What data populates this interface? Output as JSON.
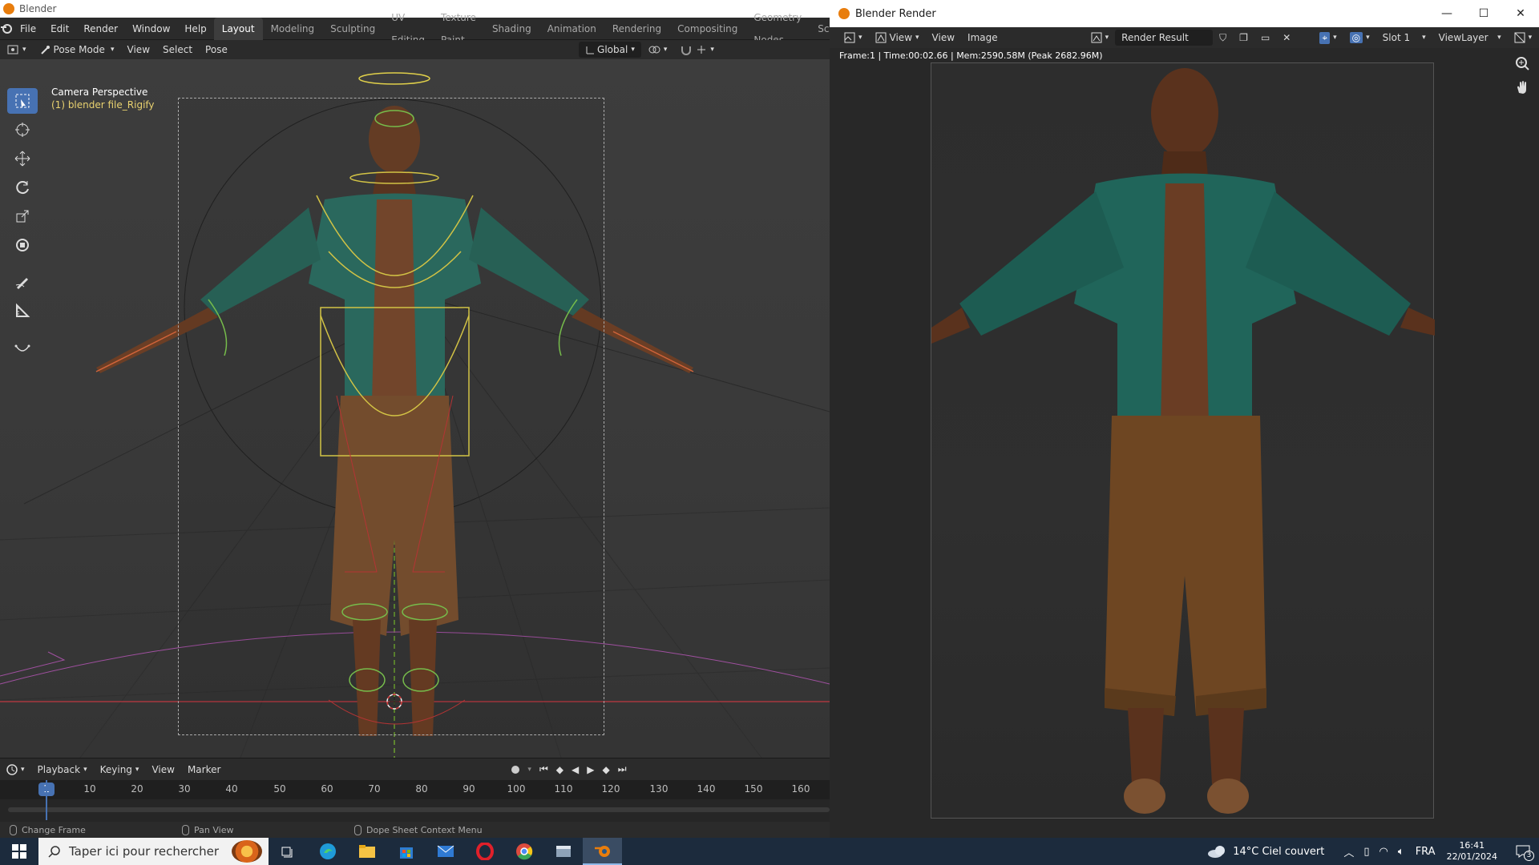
{
  "main_window": {
    "title": "Blender",
    "menu": [
      "File",
      "Edit",
      "Render",
      "Window",
      "Help"
    ],
    "workspaces": [
      "Layout",
      "Modeling",
      "Sculpting",
      "UV Editing",
      "Texture Paint",
      "Shading",
      "Animation",
      "Rendering",
      "Compositing",
      "Geometry Nodes",
      "Scriptin"
    ],
    "active_workspace": "Layout"
  },
  "viewport_header": {
    "mode": "Pose Mode",
    "menus": [
      "View",
      "Select",
      "Pose"
    ],
    "orientation": "Global"
  },
  "viewport": {
    "camera_label": "Camera Perspective",
    "object_label": "(1) blender file_Rigify"
  },
  "timeline": {
    "menus": [
      "Playback",
      "Keying",
      "View",
      "Marker"
    ],
    "current_frame": "1",
    "ticks": [
      "10",
      "20",
      "30",
      "40",
      "50",
      "60",
      "70",
      "80",
      "90",
      "100",
      "110",
      "120",
      "130",
      "140",
      "150",
      "160"
    ]
  },
  "statusbar": {
    "items": [
      "Change Frame",
      "Pan View",
      "Dope Sheet Context Menu"
    ]
  },
  "render_window": {
    "title": "Blender Render",
    "view_menu": "View",
    "menus": [
      "View",
      "Image"
    ],
    "image_name": "Render Result",
    "slot": "Slot 1",
    "view_layer": "ViewLayer",
    "info": "Frame:1 | Time:00:02.66 | Mem:2590.58M (Peak 2682.96M)"
  },
  "taskbar": {
    "search_placeholder": "Taper ici pour rechercher",
    "weather": "14°C  Ciel couvert",
    "language": "FRA",
    "time": "16:41",
    "date": "22/01/2024",
    "notifications": "3"
  },
  "colors": {
    "accent": "#4772b3",
    "blender_orange": "#e87d0d",
    "bone_yellow": "#e0d04a",
    "bone_green": "#7ec850"
  }
}
